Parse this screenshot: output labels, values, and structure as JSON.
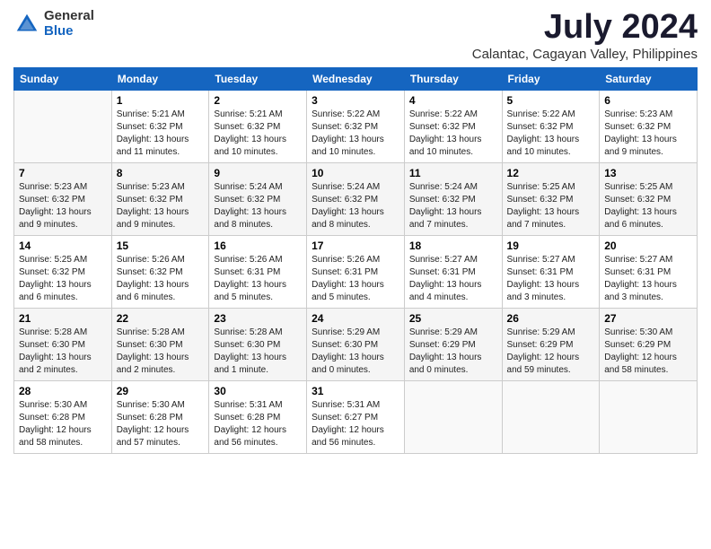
{
  "logo": {
    "general": "General",
    "blue": "Blue"
  },
  "title": {
    "month": "July 2024",
    "location": "Calantac, Cagayan Valley, Philippines"
  },
  "headers": [
    "Sunday",
    "Monday",
    "Tuesday",
    "Wednesday",
    "Thursday",
    "Friday",
    "Saturday"
  ],
  "weeks": [
    [
      {
        "day": "",
        "sunrise": "",
        "sunset": "",
        "daylight": ""
      },
      {
        "day": "1",
        "sunrise": "Sunrise: 5:21 AM",
        "sunset": "Sunset: 6:32 PM",
        "daylight": "Daylight: 13 hours and 11 minutes."
      },
      {
        "day": "2",
        "sunrise": "Sunrise: 5:21 AM",
        "sunset": "Sunset: 6:32 PM",
        "daylight": "Daylight: 13 hours and 10 minutes."
      },
      {
        "day": "3",
        "sunrise": "Sunrise: 5:22 AM",
        "sunset": "Sunset: 6:32 PM",
        "daylight": "Daylight: 13 hours and 10 minutes."
      },
      {
        "day": "4",
        "sunrise": "Sunrise: 5:22 AM",
        "sunset": "Sunset: 6:32 PM",
        "daylight": "Daylight: 13 hours and 10 minutes."
      },
      {
        "day": "5",
        "sunrise": "Sunrise: 5:22 AM",
        "sunset": "Sunset: 6:32 PM",
        "daylight": "Daylight: 13 hours and 10 minutes."
      },
      {
        "day": "6",
        "sunrise": "Sunrise: 5:23 AM",
        "sunset": "Sunset: 6:32 PM",
        "daylight": "Daylight: 13 hours and 9 minutes."
      }
    ],
    [
      {
        "day": "7",
        "sunrise": "Sunrise: 5:23 AM",
        "sunset": "Sunset: 6:32 PM",
        "daylight": "Daylight: 13 hours and 9 minutes."
      },
      {
        "day": "8",
        "sunrise": "Sunrise: 5:23 AM",
        "sunset": "Sunset: 6:32 PM",
        "daylight": "Daylight: 13 hours and 9 minutes."
      },
      {
        "day": "9",
        "sunrise": "Sunrise: 5:24 AM",
        "sunset": "Sunset: 6:32 PM",
        "daylight": "Daylight: 13 hours and 8 minutes."
      },
      {
        "day": "10",
        "sunrise": "Sunrise: 5:24 AM",
        "sunset": "Sunset: 6:32 PM",
        "daylight": "Daylight: 13 hours and 8 minutes."
      },
      {
        "day": "11",
        "sunrise": "Sunrise: 5:24 AM",
        "sunset": "Sunset: 6:32 PM",
        "daylight": "Daylight: 13 hours and 7 minutes."
      },
      {
        "day": "12",
        "sunrise": "Sunrise: 5:25 AM",
        "sunset": "Sunset: 6:32 PM",
        "daylight": "Daylight: 13 hours and 7 minutes."
      },
      {
        "day": "13",
        "sunrise": "Sunrise: 5:25 AM",
        "sunset": "Sunset: 6:32 PM",
        "daylight": "Daylight: 13 hours and 6 minutes."
      }
    ],
    [
      {
        "day": "14",
        "sunrise": "Sunrise: 5:25 AM",
        "sunset": "Sunset: 6:32 PM",
        "daylight": "Daylight: 13 hours and 6 minutes."
      },
      {
        "day": "15",
        "sunrise": "Sunrise: 5:26 AM",
        "sunset": "Sunset: 6:32 PM",
        "daylight": "Daylight: 13 hours and 6 minutes."
      },
      {
        "day": "16",
        "sunrise": "Sunrise: 5:26 AM",
        "sunset": "Sunset: 6:31 PM",
        "daylight": "Daylight: 13 hours and 5 minutes."
      },
      {
        "day": "17",
        "sunrise": "Sunrise: 5:26 AM",
        "sunset": "Sunset: 6:31 PM",
        "daylight": "Daylight: 13 hours and 5 minutes."
      },
      {
        "day": "18",
        "sunrise": "Sunrise: 5:27 AM",
        "sunset": "Sunset: 6:31 PM",
        "daylight": "Daylight: 13 hours and 4 minutes."
      },
      {
        "day": "19",
        "sunrise": "Sunrise: 5:27 AM",
        "sunset": "Sunset: 6:31 PM",
        "daylight": "Daylight: 13 hours and 3 minutes."
      },
      {
        "day": "20",
        "sunrise": "Sunrise: 5:27 AM",
        "sunset": "Sunset: 6:31 PM",
        "daylight": "Daylight: 13 hours and 3 minutes."
      }
    ],
    [
      {
        "day": "21",
        "sunrise": "Sunrise: 5:28 AM",
        "sunset": "Sunset: 6:30 PM",
        "daylight": "Daylight: 13 hours and 2 minutes."
      },
      {
        "day": "22",
        "sunrise": "Sunrise: 5:28 AM",
        "sunset": "Sunset: 6:30 PM",
        "daylight": "Daylight: 13 hours and 2 minutes."
      },
      {
        "day": "23",
        "sunrise": "Sunrise: 5:28 AM",
        "sunset": "Sunset: 6:30 PM",
        "daylight": "Daylight: 13 hours and 1 minute."
      },
      {
        "day": "24",
        "sunrise": "Sunrise: 5:29 AM",
        "sunset": "Sunset: 6:30 PM",
        "daylight": "Daylight: 13 hours and 0 minutes."
      },
      {
        "day": "25",
        "sunrise": "Sunrise: 5:29 AM",
        "sunset": "Sunset: 6:29 PM",
        "daylight": "Daylight: 13 hours and 0 minutes."
      },
      {
        "day": "26",
        "sunrise": "Sunrise: 5:29 AM",
        "sunset": "Sunset: 6:29 PM",
        "daylight": "Daylight: 12 hours and 59 minutes."
      },
      {
        "day": "27",
        "sunrise": "Sunrise: 5:30 AM",
        "sunset": "Sunset: 6:29 PM",
        "daylight": "Daylight: 12 hours and 58 minutes."
      }
    ],
    [
      {
        "day": "28",
        "sunrise": "Sunrise: 5:30 AM",
        "sunset": "Sunset: 6:28 PM",
        "daylight": "Daylight: 12 hours and 58 minutes."
      },
      {
        "day": "29",
        "sunrise": "Sunrise: 5:30 AM",
        "sunset": "Sunset: 6:28 PM",
        "daylight": "Daylight: 12 hours and 57 minutes."
      },
      {
        "day": "30",
        "sunrise": "Sunrise: 5:31 AM",
        "sunset": "Sunset: 6:28 PM",
        "daylight": "Daylight: 12 hours and 56 minutes."
      },
      {
        "day": "31",
        "sunrise": "Sunrise: 5:31 AM",
        "sunset": "Sunset: 6:27 PM",
        "daylight": "Daylight: 12 hours and 56 minutes."
      },
      {
        "day": "",
        "sunrise": "",
        "sunset": "",
        "daylight": ""
      },
      {
        "day": "",
        "sunrise": "",
        "sunset": "",
        "daylight": ""
      },
      {
        "day": "",
        "sunrise": "",
        "sunset": "",
        "daylight": ""
      }
    ]
  ]
}
